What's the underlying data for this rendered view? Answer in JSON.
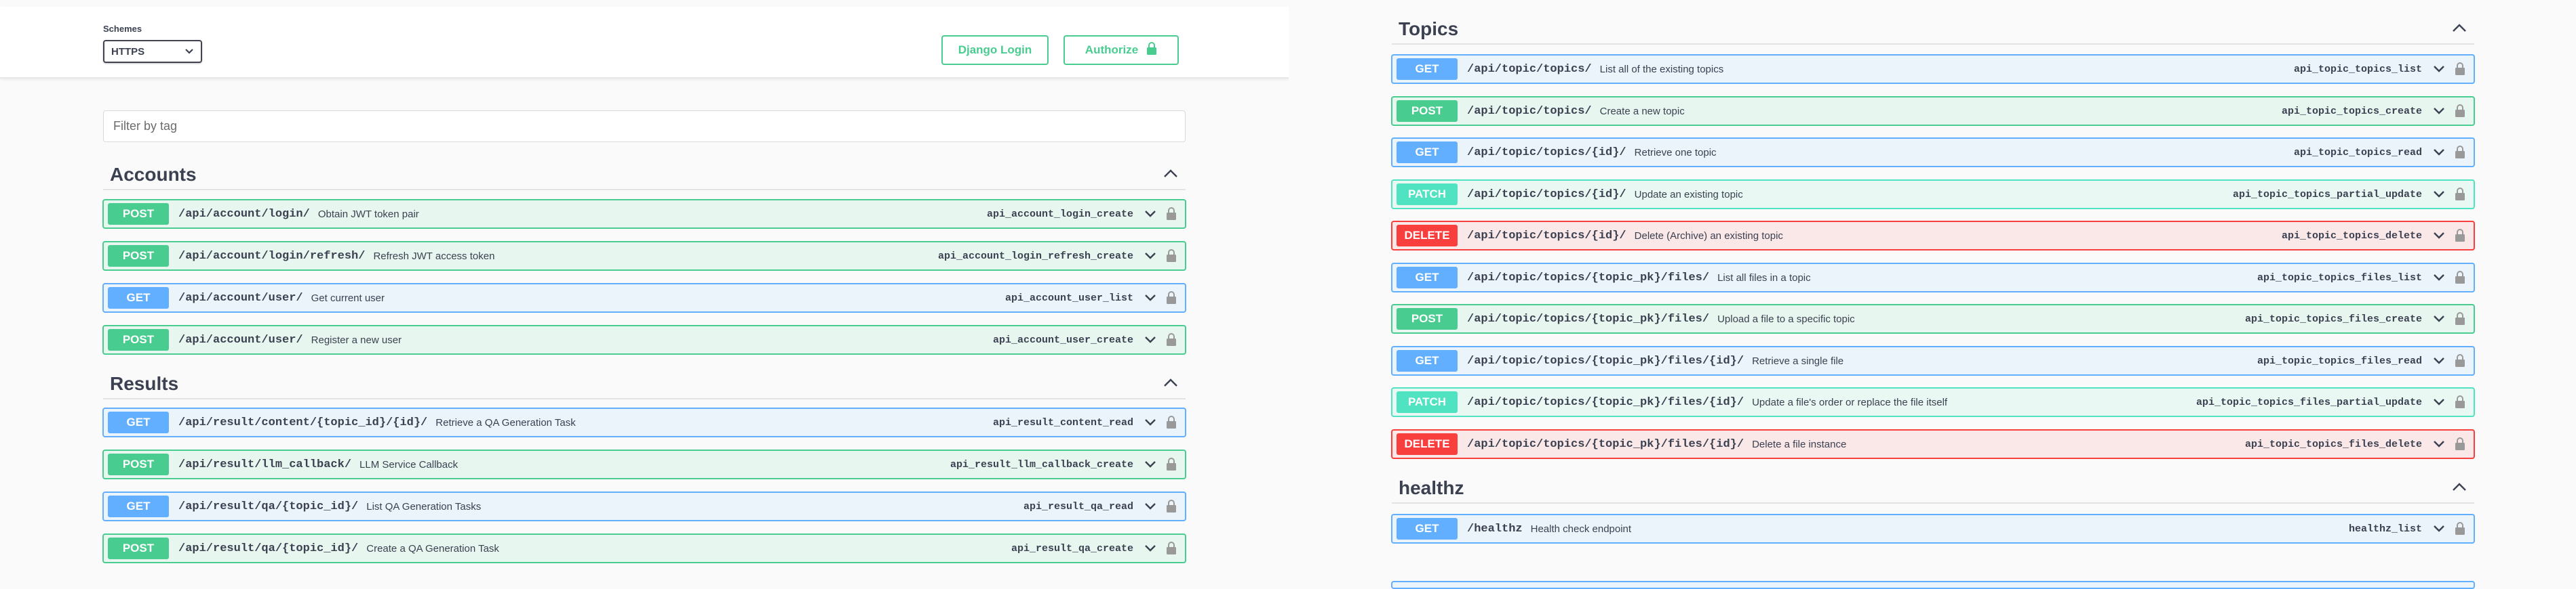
{
  "header": {
    "schemes_label": "Schemes",
    "schemes_value": "HTTPS",
    "django_login_label": "Django Login",
    "authorize_label": "Authorize"
  },
  "filter": {
    "placeholder": "Filter by tag"
  },
  "colors": {
    "get": "#61affe",
    "post": "#49cc90",
    "patch": "#50e3c2",
    "delete": "#f93e3e"
  },
  "icons": {
    "collapse": "chevron-up-icon",
    "expand": "chevron-down-icon",
    "auth": "lock-icon"
  },
  "tags": {
    "accounts": {
      "name": "Accounts",
      "operations": [
        {
          "method": "POST",
          "path": "/api/account/login/",
          "summary": "Obtain JWT token pair",
          "operation_id": "api_account_login_create"
        },
        {
          "method": "POST",
          "path": "/api/account/login/refresh/",
          "summary": "Refresh JWT access token",
          "operation_id": "api_account_login_refresh_create"
        },
        {
          "method": "GET",
          "path": "/api/account/user/",
          "summary": "Get current user",
          "operation_id": "api_account_user_list"
        },
        {
          "method": "POST",
          "path": "/api/account/user/",
          "summary": "Register a new user",
          "operation_id": "api_account_user_create"
        }
      ]
    },
    "results": {
      "name": "Results",
      "operations": [
        {
          "method": "GET",
          "path": "/api/result/content/{topic_id}/{id}/",
          "summary": "Retrieve a QA Generation Task",
          "operation_id": "api_result_content_read"
        },
        {
          "method": "POST",
          "path": "/api/result/llm_callback/",
          "summary": "LLM Service Callback",
          "operation_id": "api_result_llm_callback_create"
        },
        {
          "method": "GET",
          "path": "/api/result/qa/{topic_id}/",
          "summary": "List QA Generation Tasks",
          "operation_id": "api_result_qa_read"
        },
        {
          "method": "POST",
          "path": "/api/result/qa/{topic_id}/",
          "summary": "Create a QA Generation Task",
          "operation_id": "api_result_qa_create"
        }
      ]
    },
    "topics": {
      "name": "Topics",
      "operations": [
        {
          "method": "GET",
          "path": "/api/topic/topics/",
          "summary": "List all of the existing topics",
          "operation_id": "api_topic_topics_list"
        },
        {
          "method": "POST",
          "path": "/api/topic/topics/",
          "summary": "Create a new topic",
          "operation_id": "api_topic_topics_create"
        },
        {
          "method": "GET",
          "path": "/api/topic/topics/{id}/",
          "summary": "Retrieve one topic",
          "operation_id": "api_topic_topics_read"
        },
        {
          "method": "PATCH",
          "path": "/api/topic/topics/{id}/",
          "summary": "Update an existing topic",
          "operation_id": "api_topic_topics_partial_update"
        },
        {
          "method": "DELETE",
          "path": "/api/topic/topics/{id}/",
          "summary": "Delete (Archive) an existing topic",
          "operation_id": "api_topic_topics_delete"
        },
        {
          "method": "GET",
          "path": "/api/topic/topics/{topic_pk}/files/",
          "summary": "List all files in a topic",
          "operation_id": "api_topic_topics_files_list"
        },
        {
          "method": "POST",
          "path": "/api/topic/topics/{topic_pk}/files/",
          "summary": "Upload a file to a specific topic",
          "operation_id": "api_topic_topics_files_create"
        },
        {
          "method": "GET",
          "path": "/api/topic/topics/{topic_pk}/files/{id}/",
          "summary": "Retrieve a single file",
          "operation_id": "api_topic_topics_files_read"
        },
        {
          "method": "PATCH",
          "path": "/api/topic/topics/{topic_pk}/files/{id}/",
          "summary": "Update a file's order or replace the file itself",
          "operation_id": "api_topic_topics_files_partial_update"
        },
        {
          "method": "DELETE",
          "path": "/api/topic/topics/{topic_pk}/files/{id}/",
          "summary": "Delete a file instance",
          "operation_id": "api_topic_topics_files_delete"
        }
      ]
    },
    "healthz": {
      "name": "healthz",
      "operations": [
        {
          "method": "GET",
          "path": "/healthz",
          "summary": "Health check endpoint",
          "operation_id": "healthz_list"
        }
      ]
    }
  }
}
